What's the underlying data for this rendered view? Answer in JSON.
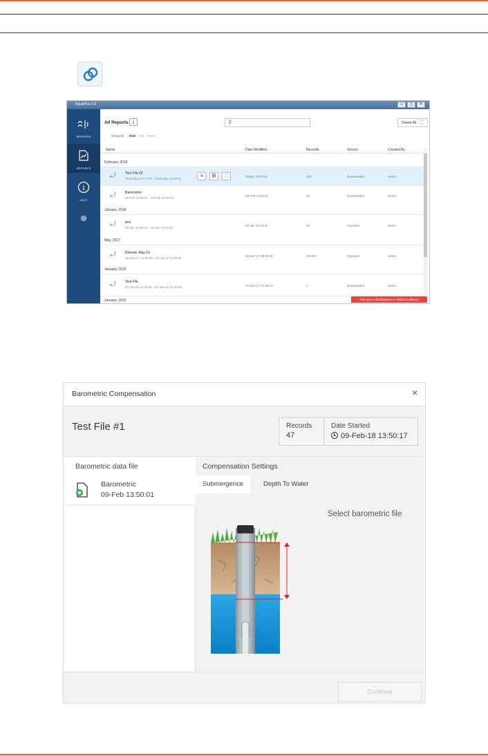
{
  "app_window": {
    "title": "AquaPlus 2.0",
    "window_buttons": [
      "▭",
      "◻",
      "✕"
    ],
    "sidebar": [
      {
        "label": "SENSORS",
        "icon": "sensors-icon"
      },
      {
        "label": "REPORTS",
        "icon": "reports-icon",
        "active": true
      },
      {
        "label": "HELP",
        "icon": "help-icon"
      },
      {
        "label": "",
        "icon": "gear-icon"
      }
    ],
    "toolbar": {
      "all_reports": "All Reports",
      "delete_all": "Delete All",
      "group_by": "Group by",
      "group_options": [
        "Date",
        "Site",
        "Name"
      ]
    },
    "columns": [
      "Name",
      "Date Modified",
      "Records",
      "Source",
      "Created By"
    ],
    "groups": [
      {
        "label": "February, 2018",
        "rows": [
          {
            "name": "Test File #2",
            "range": "Yesterday 13:27:53 - Yesterday 13:29:32",
            "modified": "Today, 13:02:13",
            "records": "109",
            "source": "Downloaded",
            "created_by": "seanv",
            "selected": true
          },
          {
            "name": "Barometric",
            "range": "09-Feb 13:59:01 - 09-Feb 13:59:18",
            "modified": "09-Feb 13:50:11",
            "records": "18",
            "source": "Downloaded",
            "created_by": "seanv"
          }
        ]
      },
      {
        "label": "January, 2018",
        "rows": [
          {
            "name": "test",
            "range": "03-Jan 12:58:23 - 03-Jan 13:04:23",
            "modified": "04-Jan 12:44:31",
            "records": "15",
            "source": "Imported",
            "created_by": "seanv"
          }
        ]
      },
      {
        "label": "May, 2017",
        "rows": [
          {
            "name": "Kleemie May 16",
            "range": "26-May-17 11:00:00 - 27-Jul-17 12:55:00",
            "modified": "15-Dec-17 08:29:41",
            "records": "18,000",
            "source": "Imported",
            "created_by": "seanv"
          }
        ]
      },
      {
        "label": "January, 2015",
        "rows": [
          {
            "name": "Test File",
            "range": "01-Jan-15 21:45:56 - 01-Jan-15 21:45:56",
            "modified": "20-Nov-17 14:29:12",
            "records": "1",
            "source": "Downloaded",
            "created_by": "seanv"
          }
        ]
      },
      {
        "label": "January, 2010",
        "rows": []
      }
    ],
    "notice": "This app is distributed to a limited audience"
  },
  "dialog": {
    "title": "Barometric Compensation",
    "close": "×",
    "file_title": "Test File #1",
    "records_label": "Records",
    "records_value": "47",
    "date_started_label": "Date Started",
    "date_started_value": "09-Feb-18 13:50:17",
    "baro_section_title": "Barometric data file",
    "baro_file_name": "Barometric",
    "baro_file_date": "09-Feb 13:50:01",
    "compensation_title": "Compensation Settings",
    "tabs": [
      "Submergence",
      "Depth To Water"
    ],
    "select_text": "Select barometric file",
    "continue_label": "Continue"
  }
}
